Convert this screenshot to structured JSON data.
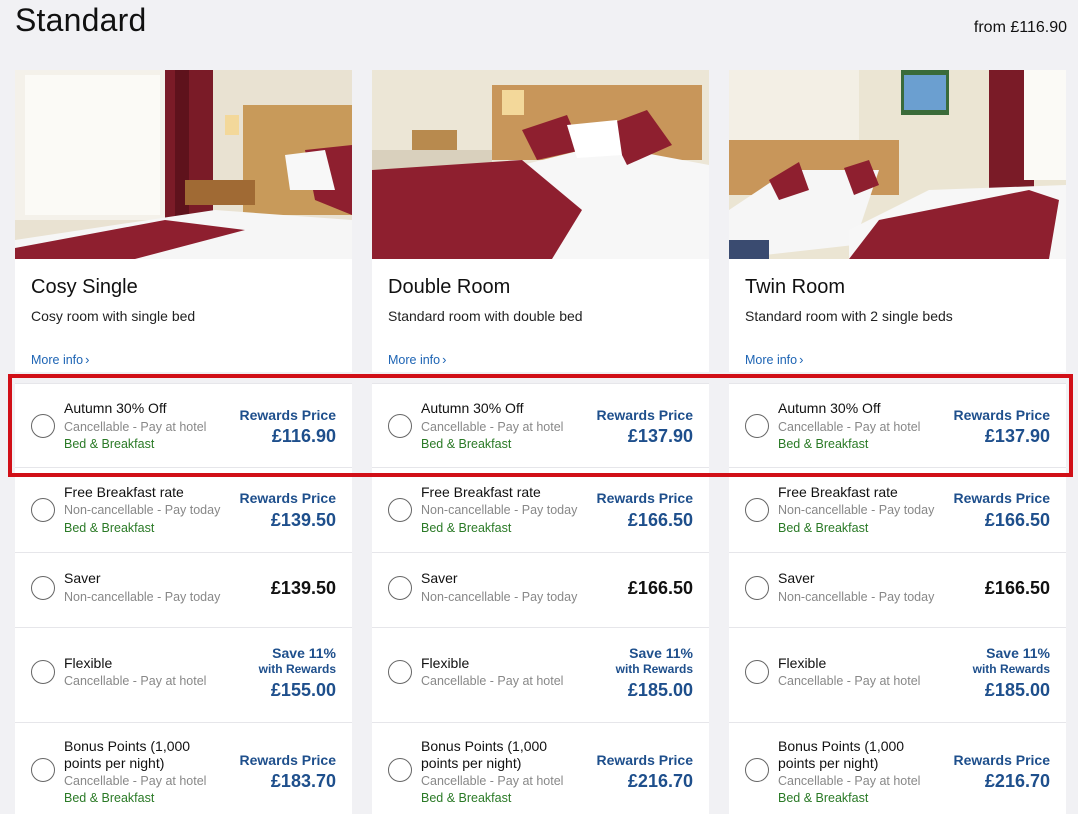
{
  "section": {
    "title": "Standard",
    "from_price": "from £116.90"
  },
  "rooms": [
    {
      "name": "Cosy Single",
      "description": "Cosy room with single bed",
      "more_info": "More info",
      "rates": [
        {
          "name": "Autumn 30% Off",
          "terms": "Cancellable - Pay at hotel",
          "board": "Bed & Breakfast",
          "price_label": "Rewards Price",
          "price": "£116.90"
        },
        {
          "name": "Free Breakfast rate",
          "terms": "Non-cancellable - Pay today",
          "board": "Bed & Breakfast",
          "price_label": "Rewards Price",
          "price": "£139.50"
        },
        {
          "name": "Saver",
          "terms": "Non-cancellable - Pay today",
          "price": "£139.50"
        },
        {
          "name": "Flexible",
          "terms": "Cancellable - Pay at hotel",
          "price_label": "Save 11%",
          "price_sub": "with Rewards",
          "price": "£155.00"
        },
        {
          "name": "Bonus Points (1,000 points per night)",
          "terms": "Cancellable - Pay at hotel",
          "board": "Bed & Breakfast",
          "price_label": "Rewards Price",
          "price": "£183.70"
        }
      ]
    },
    {
      "name": "Double Room",
      "description": "Standard room with double bed",
      "more_info": "More info",
      "rates": [
        {
          "name": "Autumn 30% Off",
          "terms": "Cancellable - Pay at hotel",
          "board": "Bed & Breakfast",
          "price_label": "Rewards Price",
          "price": "£137.90"
        },
        {
          "name": "Free Breakfast rate",
          "terms": "Non-cancellable - Pay today",
          "board": "Bed & Breakfast",
          "price_label": "Rewards Price",
          "price": "£166.50"
        },
        {
          "name": "Saver",
          "terms": "Non-cancellable - Pay today",
          "price": "£166.50"
        },
        {
          "name": "Flexible",
          "terms": "Cancellable - Pay at hotel",
          "price_label": "Save 11%",
          "price_sub": "with Rewards",
          "price": "£185.00"
        },
        {
          "name": "Bonus Points (1,000 points per night)",
          "terms": "Cancellable - Pay at hotel",
          "board": "Bed & Breakfast",
          "price_label": "Rewards Price",
          "price": "£216.70"
        }
      ]
    },
    {
      "name": "Twin Room",
      "description": "Standard room with 2 single beds",
      "more_info": "More info",
      "rates": [
        {
          "name": "Autumn 30% Off",
          "terms": "Cancellable - Pay at hotel",
          "board": "Bed & Breakfast",
          "price_label": "Rewards Price",
          "price": "£137.90"
        },
        {
          "name": "Free Breakfast rate",
          "terms": "Non-cancellable - Pay today",
          "board": "Bed & Breakfast",
          "price_label": "Rewards Price",
          "price": "£166.50"
        },
        {
          "name": "Saver",
          "terms": "Non-cancellable - Pay today",
          "price": "£166.50"
        },
        {
          "name": "Flexible",
          "terms": "Cancellable - Pay at hotel",
          "price_label": "Save 11%",
          "price_sub": "with Rewards",
          "price": "£185.00"
        },
        {
          "name": "Bonus Points (1,000 points per night)",
          "terms": "Cancellable - Pay at hotel",
          "board": "Bed & Breakfast",
          "price_label": "Rewards Price",
          "price": "£216.70"
        }
      ]
    }
  ],
  "colors": {
    "accent_blue": "#1e4f8c",
    "link_blue": "#1d64b4",
    "board_green": "#2a7a26",
    "highlight_red": "#d10f17",
    "bedspread": "#8e1f2f"
  }
}
